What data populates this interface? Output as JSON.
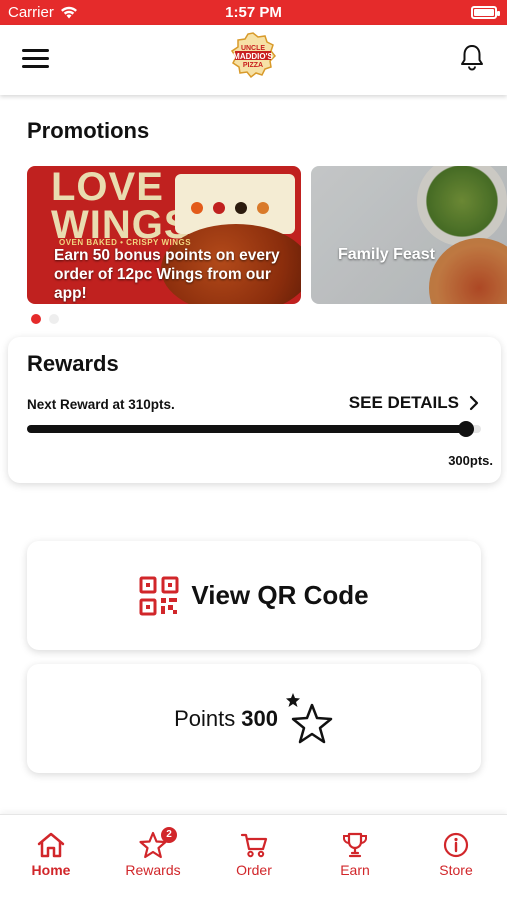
{
  "status_bar": {
    "carrier": "Carrier",
    "time": "1:57 PM",
    "battery_level": 1.0
  },
  "header": {
    "logo_lines": [
      "UNCLE",
      "MADDIO'S",
      "PIZZA"
    ]
  },
  "promotions": {
    "title": "Promotions",
    "cards": [
      {
        "headline": "LOVE WINGS?",
        "subhead": "OVEN BAKED • CRISPY WINGS",
        "text": "Earn 50 bonus points on every order of 12pc Wings from our app!"
      },
      {
        "text": "Family Feast"
      }
    ],
    "page_count": 2,
    "active_page": 1
  },
  "rewards": {
    "title": "Rewards",
    "next_reward": "Next Reward at 310pts.",
    "see_details": "SEE DETAILS",
    "progress": 0.968,
    "points_label": "300pts."
  },
  "actions": {
    "qr_label": "View QR Code",
    "points_label": "Points",
    "points_value": "300"
  },
  "tabs": [
    {
      "label": "Home",
      "icon": "home-icon",
      "active": true
    },
    {
      "label": "Rewards",
      "icon": "star-icon",
      "badge": "2"
    },
    {
      "label": "Order",
      "icon": "cart-icon"
    },
    {
      "label": "Earn",
      "icon": "trophy-icon"
    },
    {
      "label": "Store",
      "icon": "info-icon"
    }
  ],
  "colors": {
    "brand_red": "#d1262a",
    "status_bar": "#e52b2b",
    "text": "#111111"
  }
}
